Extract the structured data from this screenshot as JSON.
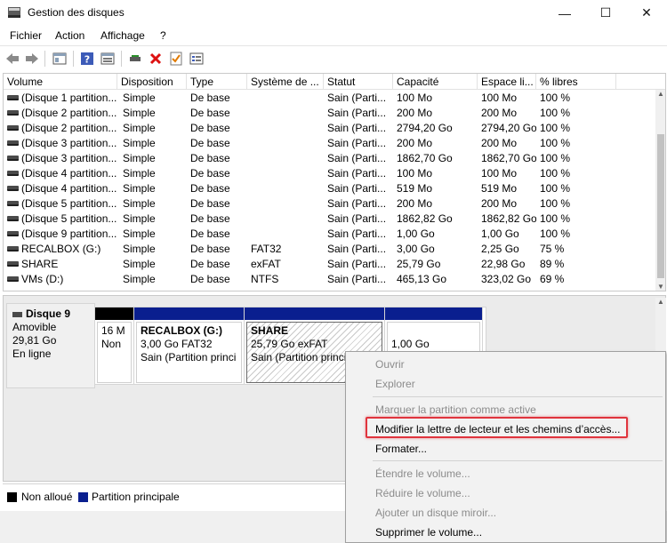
{
  "window": {
    "title": "Gestion des disques",
    "minimize": "—",
    "maximize": "☐",
    "close": "✕"
  },
  "menu": {
    "items": [
      "Fichier",
      "Action",
      "Affichage",
      "?"
    ]
  },
  "toolbar": {
    "icons": [
      "back-arrow-icon",
      "forward-arrow-icon",
      "console-tree-icon",
      "help-icon",
      "properties-icon",
      "connect-icon",
      "delete-icon",
      "check-icon",
      "settings-icon"
    ]
  },
  "volumes": {
    "columns": [
      "Volume",
      "Disposition",
      "Type",
      "Système de ...",
      "Statut",
      "Capacité",
      "Espace li...",
      "% libres"
    ],
    "rows": [
      [
        "(Disque 1 partition...",
        "Simple",
        "De base",
        "",
        "Sain (Parti...",
        "100 Mo",
        "100 Mo",
        "100 %"
      ],
      [
        "(Disque 2 partition...",
        "Simple",
        "De base",
        "",
        "Sain (Parti...",
        "200 Mo",
        "200 Mo",
        "100 %"
      ],
      [
        "(Disque 2 partition...",
        "Simple",
        "De base",
        "",
        "Sain (Parti...",
        "2794,20 Go",
        "2794,20 Go",
        "100 %"
      ],
      [
        "(Disque 3 partition...",
        "Simple",
        "De base",
        "",
        "Sain (Parti...",
        "200 Mo",
        "200 Mo",
        "100 %"
      ],
      [
        "(Disque 3 partition...",
        "Simple",
        "De base",
        "",
        "Sain (Parti...",
        "1862,70 Go",
        "1862,70 Go",
        "100 %"
      ],
      [
        "(Disque 4 partition...",
        "Simple",
        "De base",
        "",
        "Sain (Parti...",
        "100 Mo",
        "100 Mo",
        "100 %"
      ],
      [
        "(Disque 4 partition...",
        "Simple",
        "De base",
        "",
        "Sain (Parti...",
        "519 Mo",
        "519 Mo",
        "100 %"
      ],
      [
        "(Disque 5 partition...",
        "Simple",
        "De base",
        "",
        "Sain (Parti...",
        "200 Mo",
        "200 Mo",
        "100 %"
      ],
      [
        "(Disque 5 partition...",
        "Simple",
        "De base",
        "",
        "Sain (Parti...",
        "1862,82 Go",
        "1862,82 Go",
        "100 %"
      ],
      [
        "(Disque 9 partition...",
        "Simple",
        "De base",
        "",
        "Sain (Parti...",
        "1,00 Go",
        "1,00 Go",
        "100 %"
      ],
      [
        "RECALBOX (G:)",
        "Simple",
        "De base",
        "FAT32",
        "Sain (Parti...",
        "3,00 Go",
        "2,25 Go",
        "75 %"
      ],
      [
        "SHARE",
        "Simple",
        "De base",
        "exFAT",
        "Sain (Parti...",
        "25,79 Go",
        "22,98 Go",
        "89 %"
      ],
      [
        "VMs (D:)",
        "Simple",
        "De base",
        "NTFS",
        "Sain (Parti...",
        "465,13 Go",
        "323,02 Go",
        "69 %"
      ]
    ]
  },
  "disk": {
    "name": "Disque 9",
    "type": "Amovible",
    "size": "29,81 Go",
    "status": "En ligne",
    "partitions": [
      {
        "line1": "16 M",
        "line2": "Non",
        "line3": "",
        "bar_color": "#000000"
      },
      {
        "name": "RECALBOX  (G:)",
        "line2": "3,00 Go FAT32",
        "line3": "Sain (Partition princi",
        "bar_color": "#0a1f8f"
      },
      {
        "name": "SHARE",
        "line2": "25,79 Go exFAT",
        "line3": "Sain (Partition princi",
        "bar_color": "#0a1f8f"
      },
      {
        "line1": "",
        "line2": "1,00 Go",
        "line3": "",
        "bar_color": "#0a1f8f"
      }
    ]
  },
  "legend": {
    "unallocated": "Non alloué",
    "primary": "Partition principale",
    "unallocated_color": "#000000",
    "primary_color": "#0a1f8f"
  },
  "context_menu": {
    "open": "Ouvrir",
    "explore": "Explorer",
    "mark_active": "Marquer la partition comme active",
    "change_letter": "Modifier la lettre de lecteur et les chemins d’accès...",
    "format": "Formater...",
    "extend": "Étendre le volume...",
    "shrink": "Réduire le volume...",
    "mirror": "Ajouter un disque miroir...",
    "delete": "Supprimer le volume..."
  }
}
